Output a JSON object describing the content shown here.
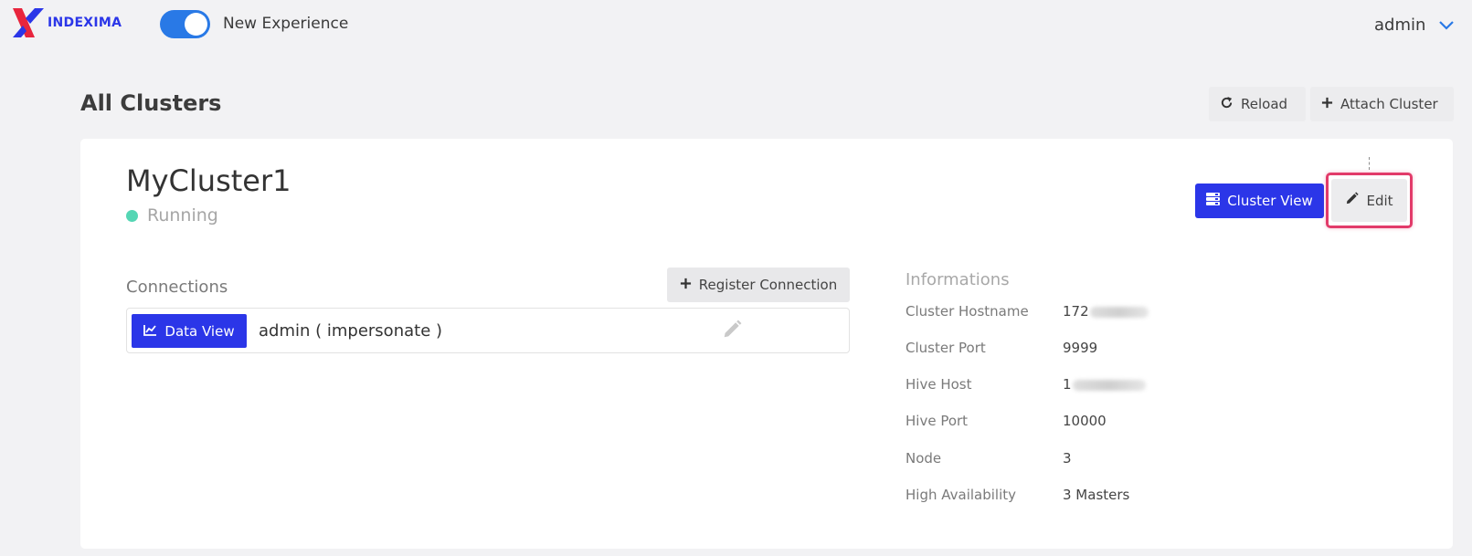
{
  "header": {
    "logo_text": "INDEXIMA",
    "toggle_label": "New Experience",
    "toggle_on": true,
    "user_name": "admin"
  },
  "page": {
    "title": "All Clusters",
    "reload_label": "Reload",
    "attach_label": "Attach Cluster"
  },
  "cluster": {
    "name": "MyCluster1",
    "status": "Running",
    "status_color": "#55d6b4",
    "cluster_view_label": "Cluster View",
    "edit_label": "Edit"
  },
  "connections": {
    "title": "Connections",
    "register_label": "Register Connection",
    "items": [
      {
        "data_view_label": "Data View",
        "user": "admin ( impersonate )"
      }
    ]
  },
  "informations": {
    "title": "Informations",
    "rows": [
      {
        "label": "Cluster Hostname",
        "value": "172"
      },
      {
        "label": "Cluster Port",
        "value": "9999"
      },
      {
        "label": "Hive Host",
        "value": "1"
      },
      {
        "label": "Hive Port",
        "value": "10000"
      },
      {
        "label": "Node",
        "value": "3"
      },
      {
        "label": "High Availability",
        "value": "3 Masters"
      }
    ]
  },
  "colors": {
    "primary": "#2b36e8",
    "toggle": "#2979e6",
    "highlight": "#e23b6a",
    "logo_red": "#e8253d"
  },
  "icons": [
    "logo-icon",
    "chevron-down-icon",
    "reload-icon",
    "plus-icon",
    "server-stack-icon",
    "pencil-icon",
    "chart-line-icon"
  ]
}
